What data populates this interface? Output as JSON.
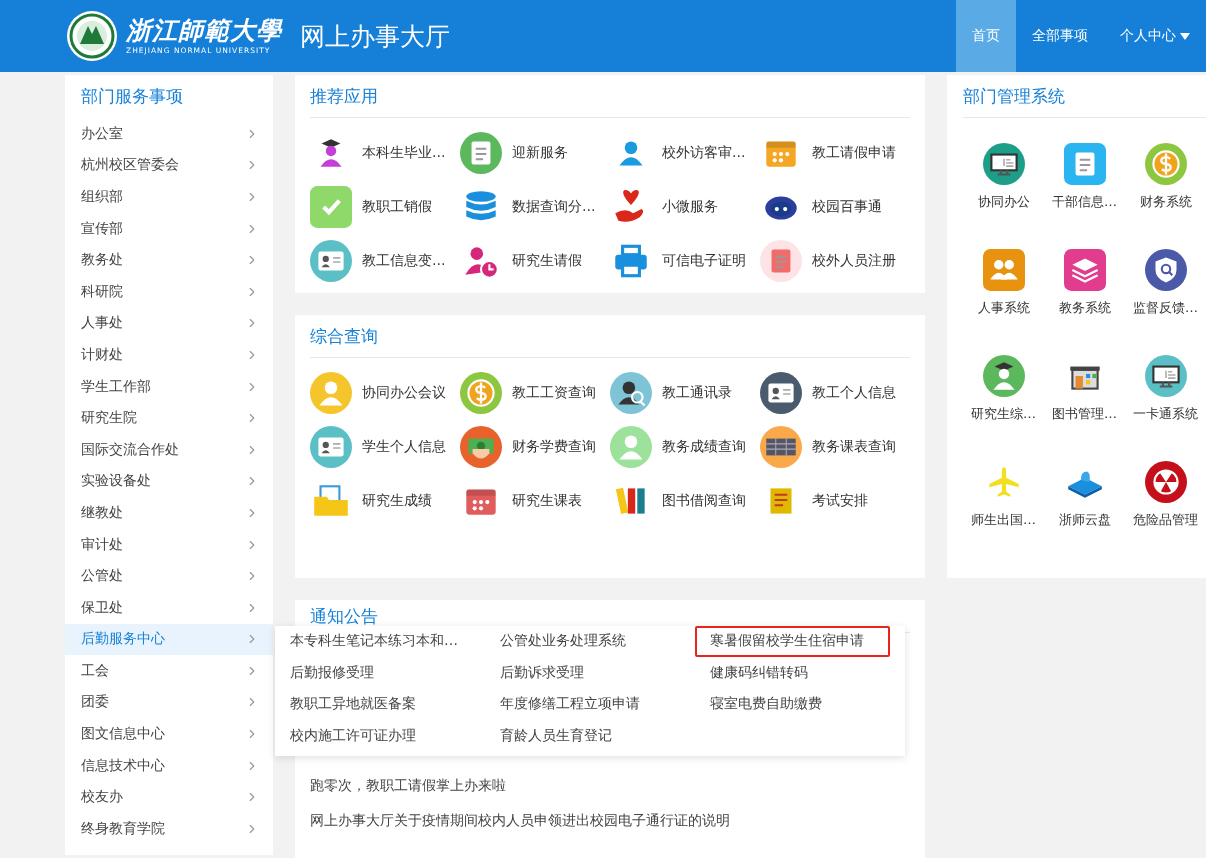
{
  "header": {
    "logo_name": "浙江師範大學",
    "logo_subname": "ZHEJIANG NORMAL UNIVERSITY",
    "title": "网上办事大厅",
    "nav": [
      {
        "label": "首页",
        "selected": true,
        "has_menu": false
      },
      {
        "label": "全部事项",
        "selected": false,
        "has_menu": false
      },
      {
        "label": "个人中心",
        "selected": false,
        "has_menu": true
      }
    ]
  },
  "sidebar": {
    "title": "部门服务事项",
    "items": [
      {
        "label": "办公室",
        "selected": false
      },
      {
        "label": "杭州校区管委会",
        "selected": false
      },
      {
        "label": "组织部",
        "selected": false
      },
      {
        "label": "宣传部",
        "selected": false
      },
      {
        "label": "教务处",
        "selected": false
      },
      {
        "label": "科研院",
        "selected": false
      },
      {
        "label": "人事处",
        "selected": false
      },
      {
        "label": "计财处",
        "selected": false
      },
      {
        "label": "学生工作部",
        "selected": false
      },
      {
        "label": "研究生院",
        "selected": false
      },
      {
        "label": "国际交流合作处",
        "selected": false
      },
      {
        "label": "实验设备处",
        "selected": false
      },
      {
        "label": "继教处",
        "selected": false
      },
      {
        "label": "审计处",
        "selected": false
      },
      {
        "label": "公管处",
        "selected": false
      },
      {
        "label": "保卫处",
        "selected": false
      },
      {
        "label": "后勤服务中心",
        "selected": true
      },
      {
        "label": "工会",
        "selected": false
      },
      {
        "label": "团委",
        "selected": false
      },
      {
        "label": "图文信息中心",
        "selected": false
      },
      {
        "label": "信息技术中心",
        "selected": false
      },
      {
        "label": "校友办",
        "selected": false
      },
      {
        "label": "终身教育学院",
        "selected": false
      }
    ],
    "flyout": [
      {
        "label": "本专科生笔记本练习本和…",
        "outlined": false
      },
      {
        "label": "公管处业务处理系统",
        "outlined": false
      },
      {
        "label": "寒暑假留校学生住宿申请",
        "outlined": true
      },
      {
        "label": "后勤报修受理",
        "outlined": false
      },
      {
        "label": "后勤诉求受理",
        "outlined": false
      },
      {
        "label": "健康码纠错转码",
        "outlined": false
      },
      {
        "label": "教职工异地就医备案",
        "outlined": false
      },
      {
        "label": "年度修缮工程立项申请",
        "outlined": false
      },
      {
        "label": "寝室电费自助缴费",
        "outlined": false
      },
      {
        "label": "校内施工许可证办理",
        "outlined": false
      },
      {
        "label": "育龄人员生育登记",
        "outlined": false
      }
    ]
  },
  "recommended": {
    "title": "推荐应用",
    "apps": [
      {
        "label": "本科生毕业…"
      },
      {
        "label": "迎新服务"
      },
      {
        "label": "校外访客审…"
      },
      {
        "label": "教工请假申请"
      },
      {
        "label": "教职工销假"
      },
      {
        "label": "数据查询分…"
      },
      {
        "label": "小微服务"
      },
      {
        "label": "校园百事通"
      },
      {
        "label": "教工信息变…"
      },
      {
        "label": "研究生请假"
      },
      {
        "label": "可信电子证明"
      },
      {
        "label": "校外人员注册"
      }
    ]
  },
  "query": {
    "title": "综合查询",
    "apps": [
      {
        "label": "协同办公会议"
      },
      {
        "label": "教工工资查询"
      },
      {
        "label": "教工通讯录"
      },
      {
        "label": "教工个人信息"
      },
      {
        "label": "学生个人信息"
      },
      {
        "label": "财务学费查询"
      },
      {
        "label": "教务成绩查询"
      },
      {
        "label": "教务课表查询"
      },
      {
        "label": "研究生成绩"
      },
      {
        "label": "研究生课表"
      },
      {
        "label": "图书借阅查询"
      },
      {
        "label": "考试安排"
      }
    ]
  },
  "systems": {
    "title": "部门管理系统",
    "apps": [
      {
        "label": "协同办公"
      },
      {
        "label": "干部信息…"
      },
      {
        "label": "财务系统"
      },
      {
        "label": "人事系统"
      },
      {
        "label": "教务系统"
      },
      {
        "label": "监督反馈…"
      },
      {
        "label": "研究生综…"
      },
      {
        "label": "图书管理…"
      },
      {
        "label": "一卡通系统"
      },
      {
        "label": "师生出国…"
      },
      {
        "label": "浙师云盘"
      },
      {
        "label": "危险品管理"
      }
    ]
  },
  "notices": {
    "title": "通知公告",
    "items": [
      {
        "text": "跑零次，教职工请假掌上办来啦"
      },
      {
        "text": "网上办事大厅关于疫情期间校内人员申领进出校园电子通行证的说明"
      }
    ]
  }
}
